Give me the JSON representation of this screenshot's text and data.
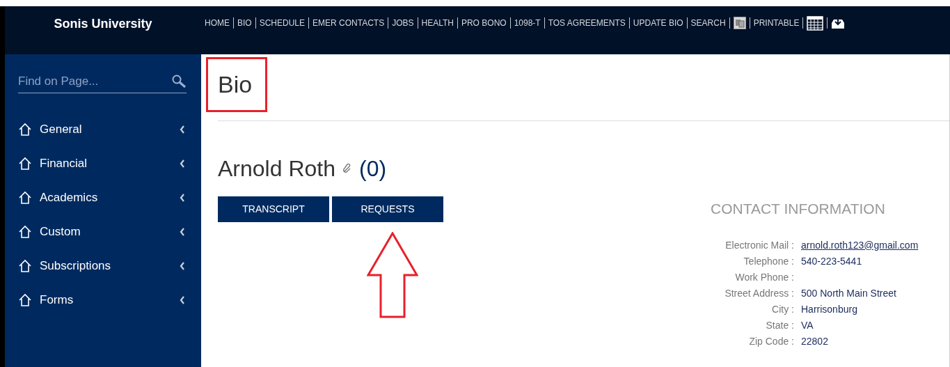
{
  "header": {
    "brand": "Sonis University",
    "nav": [
      {
        "kind": "link",
        "label": "HOME"
      },
      {
        "kind": "link",
        "label": "BIO"
      },
      {
        "kind": "link",
        "label": "SCHEDULE"
      },
      {
        "kind": "link",
        "label": "EMER CONTACTS"
      },
      {
        "kind": "link",
        "label": "JOBS"
      },
      {
        "kind": "link",
        "label": "HEALTH"
      },
      {
        "kind": "link",
        "label": "PRO BONO"
      },
      {
        "kind": "link",
        "label": "1098-T"
      },
      {
        "kind": "link",
        "label": "TOS AGREEMENTS"
      },
      {
        "kind": "link",
        "label": "UPDATE BIO"
      },
      {
        "kind": "link",
        "label": "SEARCH"
      },
      {
        "kind": "photo"
      },
      {
        "kind": "link",
        "label": "PRINTABLE"
      },
      {
        "kind": "calendar"
      },
      {
        "kind": "download"
      }
    ]
  },
  "sidebar": {
    "search": {
      "placeholder": "Find on Page..."
    },
    "items": [
      {
        "label": "General",
        "expanded": false
      },
      {
        "label": "Financial",
        "expanded": false
      },
      {
        "label": "Academics",
        "expanded": false
      },
      {
        "label": "Custom",
        "expanded": false
      },
      {
        "label": "Subscriptions",
        "expanded": false
      },
      {
        "label": "Forms",
        "expanded": false
      }
    ]
  },
  "page": {
    "title": "Bio",
    "name": "Arnold Roth",
    "count": "(0)",
    "buttons": [
      "TRANSCRIPT",
      "REQUESTS"
    ],
    "contact": {
      "title": "CONTACT INFORMATION",
      "rows": [
        {
          "label": "Electronic Mail :",
          "value": "arnold.roth123@gmail.com",
          "kind": "link"
        },
        {
          "label": "Telephone :",
          "value": "540-223-5441",
          "kind": "text"
        },
        {
          "label": "Work Phone :"
        },
        {
          "label": "Street Address :",
          "value": "500 North Main Street",
          "kind": "text"
        },
        {
          "label": "City :",
          "value": "Harrisonburg",
          "kind": "text"
        },
        {
          "label": "State :",
          "value": "VA",
          "kind": "text"
        },
        {
          "label": "Zip Code :",
          "value": "22802",
          "kind": "text"
        }
      ]
    }
  }
}
